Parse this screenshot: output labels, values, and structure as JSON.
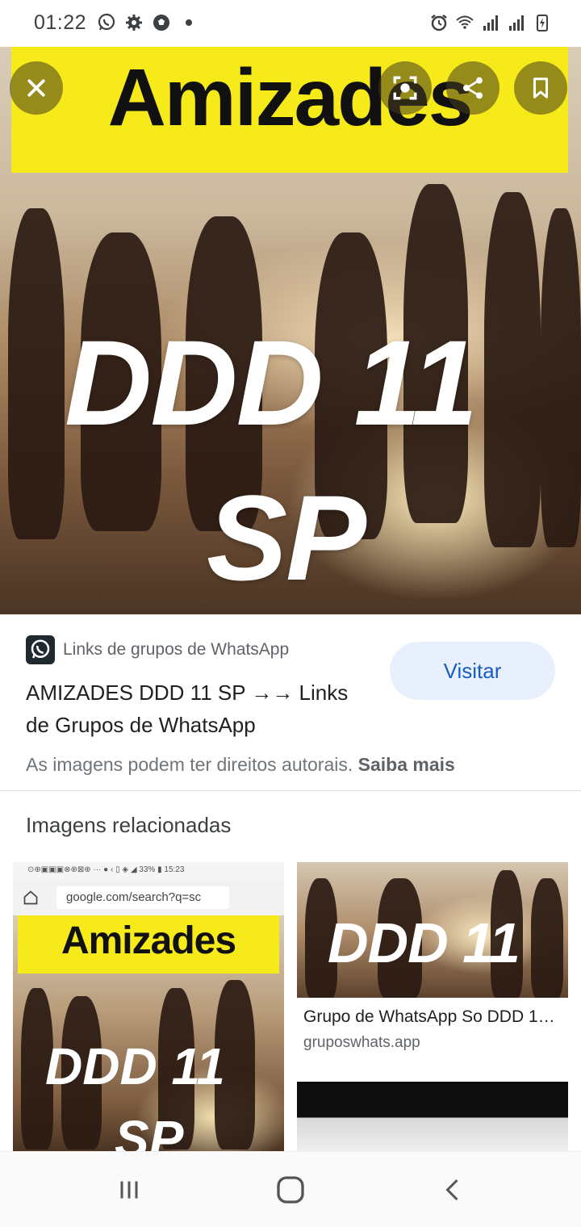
{
  "status_bar": {
    "time": "01:22",
    "left_icons": [
      "whatsapp-icon",
      "gear-icon",
      "soccer-ball-icon",
      "dot-icon"
    ],
    "right_icons": [
      "alarm-icon",
      "wifi-icon",
      "signal-icon",
      "signal-icon",
      "battery-charging-icon"
    ]
  },
  "hero": {
    "banner_text": "Amizades",
    "line1": "DDD 11",
    "line2": "SP",
    "banner_color": "#f7ea1a"
  },
  "overlay_buttons": [
    "close-icon",
    "lens-icon",
    "share-icon",
    "bookmark-icon"
  ],
  "result": {
    "site_name": "Links de grupos de WhatsApp",
    "title": "AMIZADES DDD 11 SP →→ Links de Grupos de WhatsApp",
    "visit_label": "Visitar",
    "copyright_text": "As imagens podem ter direitos autorais.",
    "learn_more": "Saiba mais"
  },
  "related": {
    "heading": "Imagens relacionadas",
    "left": {
      "status_text": "⊙⊕▣▣▣⊗⊕⊠⊕ ··· ● ‹ ▯ ◈ ◢ 33% ▮ 15:23",
      "url": "google.com/search?q=sc",
      "banner_text": "Amizades",
      "line1": "DDD 11",
      "line2": "SP"
    },
    "right": {
      "image_text": "DDD 11",
      "caption": "Grupo de WhatsApp So DDD 1…",
      "source": "gruposwhats.app"
    }
  },
  "nav": [
    "recents-icon",
    "home-icon",
    "back-icon"
  ],
  "colors": {
    "accent": "#1a5cc4",
    "visit_bg": "#e8f0fe"
  }
}
